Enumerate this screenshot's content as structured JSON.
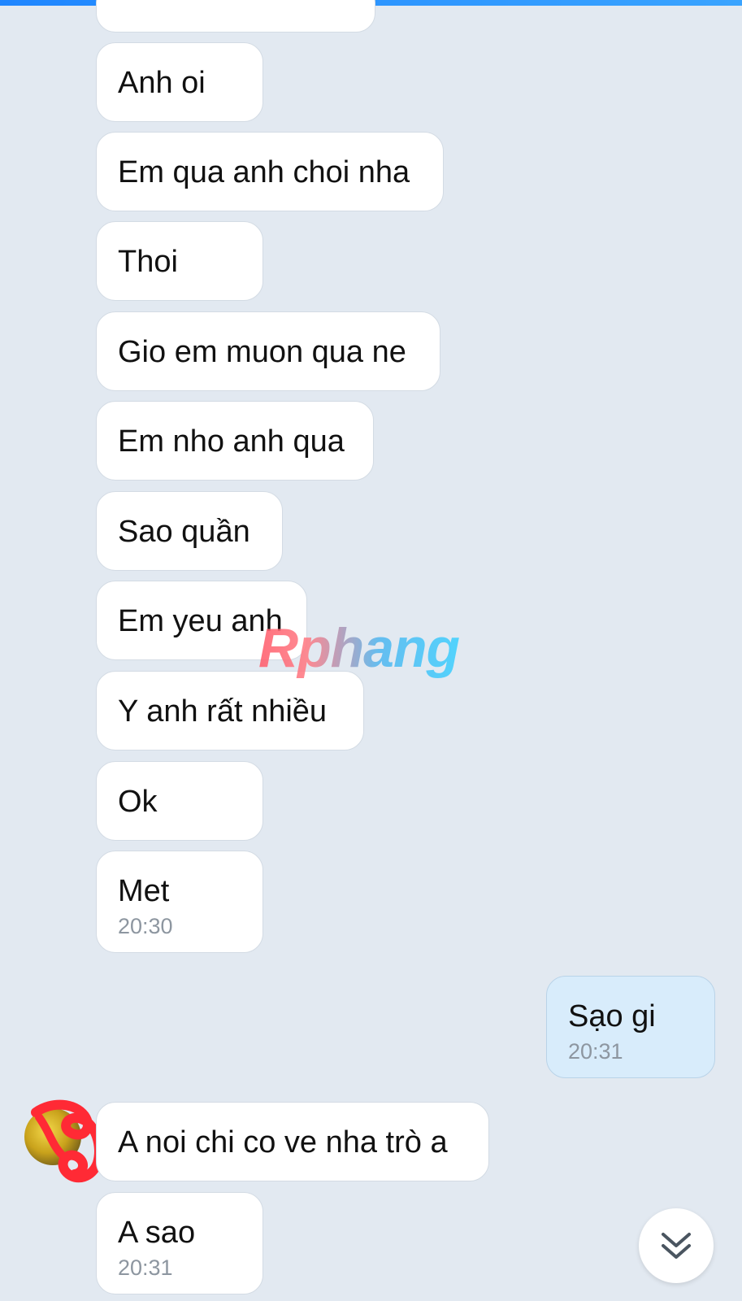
{
  "chat": {
    "incoming_group_1": [
      {
        "text": ""
      },
      {
        "text": "Anh oi"
      },
      {
        "text": "Em qua anh choi nha"
      },
      {
        "text": "Thoi"
      },
      {
        "text": "Gio em muon qua ne"
      },
      {
        "text": "Em nho anh qua"
      },
      {
        "text": "Sao quần"
      },
      {
        "text": "Em yeu anh"
      },
      {
        "text": "Y anh rất nhiều"
      },
      {
        "text": "Ok"
      },
      {
        "text": "Met",
        "time": "20:30"
      }
    ],
    "outgoing": {
      "text": "Sạo gi",
      "time": "20:31"
    },
    "incoming_group_2": [
      {
        "text": "A noi chi co ve nha trò a"
      },
      {
        "text": "A sao",
        "time": "20:31"
      }
    ]
  },
  "watermark": "Rphang",
  "icons": {
    "scroll_down": "double-chevron-down-icon",
    "avatar": "contact-avatar"
  },
  "colors": {
    "background": "#e2e9f1",
    "incoming_bubble": "#ffffff",
    "outgoing_bubble": "#d8ecfb",
    "top_bar": "#1f86ff",
    "scribble": "#ff2a35"
  }
}
